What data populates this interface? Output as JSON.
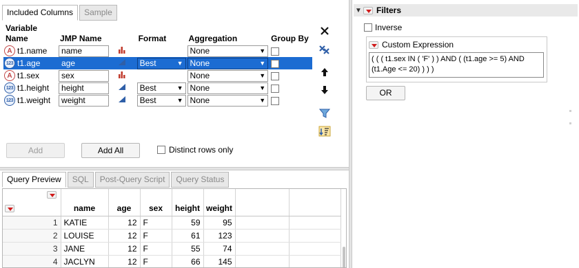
{
  "columns_panel": {
    "tabs": [
      "Included Columns",
      "Sample"
    ],
    "headers": {
      "variable_name": "Variable Name",
      "jmp_name": "JMP Name",
      "format": "Format",
      "aggregation": "Aggregation",
      "group_by": "Group By"
    },
    "rows": [
      {
        "icon": "character-type-icon",
        "variable": "t1.name",
        "jmp_name": "name",
        "modeling": "nominal",
        "format": "",
        "aggregation": "None",
        "selected": false
      },
      {
        "icon": "numeric-type-icon",
        "variable": "t1.age",
        "jmp_name": "age",
        "modeling": "continuous",
        "format": "Best",
        "aggregation": "None",
        "selected": true
      },
      {
        "icon": "character-type-icon",
        "variable": "t1.sex",
        "jmp_name": "sex",
        "modeling": "nominal",
        "format": "",
        "aggregation": "None",
        "selected": false
      },
      {
        "icon": "numeric-type-icon",
        "variable": "t1.height",
        "jmp_name": "height",
        "modeling": "continuous",
        "format": "Best",
        "aggregation": "None",
        "selected": false
      },
      {
        "icon": "numeric-type-icon",
        "variable": "t1.weight",
        "jmp_name": "weight",
        "modeling": "continuous",
        "format": "Best",
        "aggregation": "None",
        "selected": false
      }
    ],
    "add_label": "Add",
    "add_all_label": "Add All",
    "distinct_label": "Distinct rows only"
  },
  "query_panel": {
    "tabs": [
      "Query Preview",
      "SQL",
      "Post-Query Script",
      "Query Status"
    ],
    "columns": [
      "name",
      "age",
      "sex",
      "height",
      "weight"
    ],
    "rows": [
      {
        "n": "1",
        "name": "KATIE",
        "age": "12",
        "sex": "F",
        "height": "59",
        "weight": "95"
      },
      {
        "n": "2",
        "name": "LOUISE",
        "age": "12",
        "sex": "F",
        "height": "61",
        "weight": "123"
      },
      {
        "n": "3",
        "name": "JANE",
        "age": "12",
        "sex": "F",
        "height": "55",
        "weight": "74"
      },
      {
        "n": "4",
        "name": "JACLYN",
        "age": "12",
        "sex": "F",
        "height": "66",
        "weight": "145"
      }
    ]
  },
  "filters_panel": {
    "title": "Filters",
    "inverse_label": "Inverse",
    "custom_title": "Custom Expression",
    "expression": "( ( ( t1.sex IN ( 'F' ) ) AND ( (t1.age >= 5) AND (t1.Age <= 20) ) ) )",
    "or_label": "OR"
  },
  "colors": {
    "selection": "#1c6cd2",
    "red_accent": "#d01c1c",
    "nominal_bars": "#c0392b",
    "continuous_triangle": "#2f5fa8"
  }
}
